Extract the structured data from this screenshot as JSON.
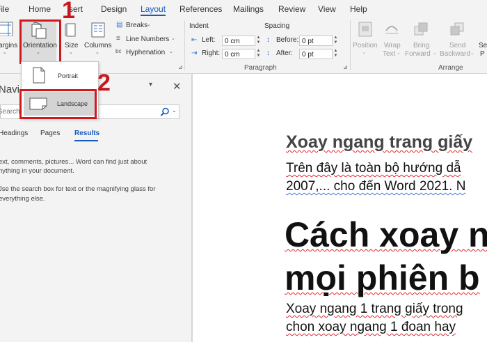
{
  "menu": {
    "tabs": [
      "File",
      "Home",
      "Insert",
      "Design",
      "Layout",
      "References",
      "Mailings",
      "Review",
      "View",
      "Help"
    ],
    "visible_labels": [
      "File",
      "Home",
      "sert",
      "Design",
      "Layout",
      "References",
      "Mailings",
      "Review",
      "View",
      "Help"
    ],
    "active_tab": "Layout"
  },
  "ribbon": {
    "margins": "argins",
    "orientation": "Orientation",
    "size": "Size",
    "columns": "Columns",
    "breaks": "Breaks",
    "line_numbers": "Line Numbers",
    "hyphenation": "Hyphenation",
    "indent": {
      "title": "Indent",
      "left_label": "Left:",
      "left_value": "0 cm",
      "right_label": "Right:",
      "right_value": "0 cm"
    },
    "spacing": {
      "title": "Spacing",
      "before_label": "Before:",
      "before_value": "0 pt",
      "after_label": "After:",
      "after_value": "0 pt"
    },
    "paragraph_group": "Paragraph",
    "arrange_group": "Arrange",
    "position": "Position",
    "wrap_text": [
      "Wrap",
      "Text"
    ],
    "bring_forward": [
      "Bring",
      "Forward"
    ],
    "send_backward": [
      "Send",
      "Backward"
    ],
    "select_partial": [
      "Sel",
      "P"
    ]
  },
  "orientation_menu": {
    "portrait": "Portrait",
    "landscape": "Landscape"
  },
  "annotations": {
    "step1": "1",
    "step2": "2"
  },
  "navigation": {
    "title": "Navi",
    "search_placeholder": "Search",
    "tabs": [
      "Headings",
      "Pages",
      "Results"
    ],
    "active_tab": "Results",
    "help_lines": [
      "ext, comments, pictures... Word can find just about",
      "nything in your document.",
      "",
      "Jse the search box for text or the magnifying glass for",
      "everything else."
    ]
  },
  "document": {
    "heading2": "Xoay ngang trang giấy",
    "para1_line1": "Trên đây là toàn bộ hướng dẫ",
    "para1_line2": "2007,... cho đến Word 2021. N",
    "heading1_line1": "Cách xoay n",
    "heading1_line2": "mọi phiên b",
    "para2_line1": "Xoay ngang 1 trang giấy trong",
    "para2_line2": "chon xoay ngang 1 đoan hay"
  },
  "colors": {
    "accent": "#185abd",
    "annotation_red": "#d0181f",
    "ribbon_bg": "#f3f3f3"
  }
}
